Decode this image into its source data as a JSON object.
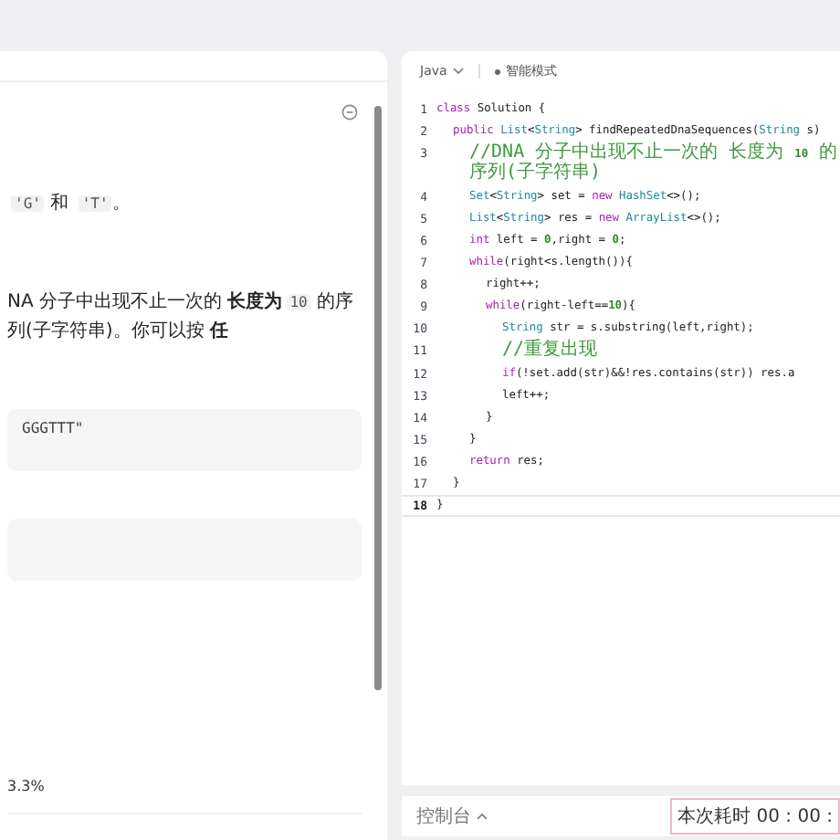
{
  "problem": {
    "paragraphs": [
      [
        {
          "kind": "code",
          "text": "'G'"
        },
        {
          "kind": "plain",
          "text": " 和 "
        },
        {
          "kind": "code",
          "text": "'T'"
        },
        {
          "kind": "plain",
          "text": "。"
        }
      ],
      [
        {
          "kind": "plain",
          "text": "NA 分子中出现不止一次的 "
        },
        {
          "kind": "bold",
          "text": "长度为"
        },
        {
          "kind": "code",
          "text": "10"
        },
        {
          "kind": "plain",
          "text": " 的序列(子字符串)。你可以按 "
        },
        {
          "kind": "bold",
          "text": "任"
        }
      ]
    ],
    "examples": [
      {
        "kind": "text",
        "text": "GGGTTT\""
      },
      {
        "kind": "blank"
      }
    ],
    "stat": "3.3%"
  },
  "editor": {
    "language": "Java",
    "mode": "智能模式",
    "lines": [
      {
        "number": "1",
        "current": false,
        "segments": [
          {
            "kind": "keyword",
            "text": "class "
          },
          {
            "kind": "plain",
            "text": "Solution {"
          }
        ],
        "children": [
          {
            "number": "2",
            "current": false,
            "segments": [
              {
                "kind": "keyword",
                "text": "public "
              },
              {
                "kind": "type",
                "text": "List"
              },
              {
                "kind": "plain",
                "text": "<"
              },
              {
                "kind": "type",
                "text": "String"
              },
              {
                "kind": "plain",
                "text": "> findRepeatedDnaSequences("
              },
              {
                "kind": "type",
                "text": "String"
              },
              {
                "kind": "plain",
                "text": " s)"
              }
            ],
            "children": [
              {
                "number": "3",
                "current": false,
                "segments": [
                  {
                    "kind": "comment",
                    "text": "//DNA 分子中出现不止一次的 长度为 "
                  },
                  {
                    "kind": "number",
                    "text": "10"
                  },
                  {
                    "kind": "comment",
                    "text": " 的序列(子字符串)"
                  }
                ]
              },
              {
                "number": "4",
                "current": false,
                "segments": [
                  {
                    "kind": "type",
                    "text": "Set"
                  },
                  {
                    "kind": "plain",
                    "text": "<"
                  },
                  {
                    "kind": "type",
                    "text": "String"
                  },
                  {
                    "kind": "plain",
                    "text": "> set = "
                  },
                  {
                    "kind": "keyword",
                    "text": "new "
                  },
                  {
                    "kind": "type",
                    "text": "HashSet"
                  },
                  {
                    "kind": "plain",
                    "text": "<>();"
                  }
                ]
              },
              {
                "number": "5",
                "current": false,
                "segments": [
                  {
                    "kind": "type",
                    "text": "List"
                  },
                  {
                    "kind": "plain",
                    "text": "<"
                  },
                  {
                    "kind": "type",
                    "text": "String"
                  },
                  {
                    "kind": "plain",
                    "text": "> res = "
                  },
                  {
                    "kind": "keyword",
                    "text": "new "
                  },
                  {
                    "kind": "type",
                    "text": "ArrayList"
                  },
                  {
                    "kind": "plain",
                    "text": "<>();"
                  }
                ]
              },
              {
                "number": "6",
                "current": false,
                "segments": [
                  {
                    "kind": "keyword",
                    "text": "int "
                  },
                  {
                    "kind": "plain",
                    "text": "left = "
                  },
                  {
                    "kind": "number",
                    "text": "0"
                  },
                  {
                    "kind": "plain",
                    "text": ",right = "
                  },
                  {
                    "kind": "number",
                    "text": "0"
                  },
                  {
                    "kind": "plain",
                    "text": ";"
                  }
                ]
              },
              {
                "number": "7",
                "current": false,
                "segments": [
                  {
                    "kind": "keyword",
                    "text": "while"
                  },
                  {
                    "kind": "plain",
                    "text": "(right<s.length()){"
                  }
                ],
                "children": [
                  {
                    "number": "8",
                    "current": false,
                    "segments": [
                      {
                        "kind": "plain",
                        "text": "right++;"
                      }
                    ]
                  },
                  {
                    "number": "9",
                    "current": false,
                    "segments": [
                      {
                        "kind": "keyword",
                        "text": "while"
                      },
                      {
                        "kind": "plain",
                        "text": "(right-left=="
                      },
                      {
                        "kind": "number",
                        "text": "10"
                      },
                      {
                        "kind": "plain",
                        "text": "){"
                      }
                    ],
                    "children": [
                      {
                        "number": "10",
                        "current": false,
                        "segments": [
                          {
                            "kind": "type",
                            "text": "String"
                          },
                          {
                            "kind": "plain",
                            "text": " str = s.substring(left,right);"
                          }
                        ]
                      },
                      {
                        "number": "11",
                        "current": false,
                        "segments": [
                          {
                            "kind": "comment",
                            "text": "//重复出现"
                          }
                        ]
                      },
                      {
                        "number": "12",
                        "current": false,
                        "segments": [
                          {
                            "kind": "keyword",
                            "text": "if"
                          },
                          {
                            "kind": "plain",
                            "text": "(!set.add(str)&&!res.contains(str)) res.a"
                          }
                        ]
                      },
                      {
                        "number": "13",
                        "current": false,
                        "segments": [
                          {
                            "kind": "plain",
                            "text": "left++;"
                          }
                        ]
                      }
                    ]
                  },
                  {
                    "number": "14",
                    "current": false,
                    "segments": [
                      {
                        "kind": "plain",
                        "text": "}"
                      }
                    ]
                  }
                ]
              },
              {
                "number": "15",
                "current": false,
                "segments": [
                  {
                    "kind": "plain",
                    "text": "}"
                  }
                ]
              },
              {
                "number": "16",
                "current": false,
                "segments": [
                  {
                    "kind": "keyword",
                    "text": "return"
                  },
                  {
                    "kind": "plain",
                    "text": " res;"
                  }
                ]
              }
            ]
          },
          {
            "number": "17",
            "current": false,
            "segments": [
              {
                "kind": "plain",
                "text": "}"
              }
            ]
          }
        ]
      },
      {
        "number": "18",
        "current": true,
        "segments": [
          {
            "kind": "plain",
            "text": "}"
          }
        ]
      }
    ]
  },
  "console": {
    "label": "控制台",
    "timer": "本次耗时 00 : 00 :"
  }
}
